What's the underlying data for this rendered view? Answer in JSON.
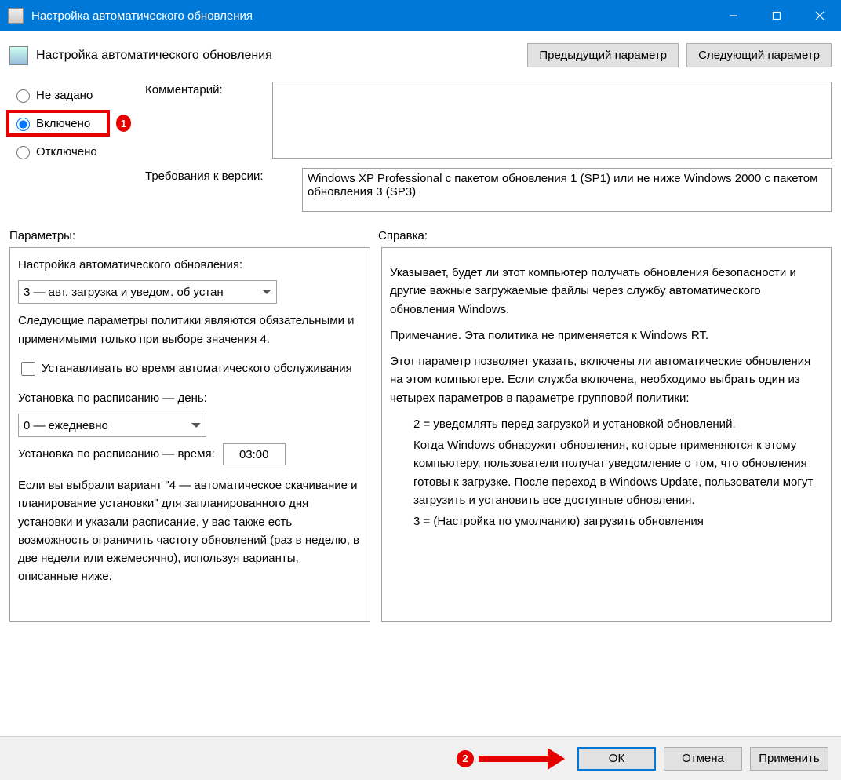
{
  "window": {
    "title": "Настройка автоматического обновления"
  },
  "header": {
    "setting_title": "Настройка автоматического обновления",
    "prev": "Предыдущий параметр",
    "next": "Следующий параметр"
  },
  "state": {
    "not_configured": "Не задано",
    "enabled": "Включено",
    "disabled": "Отключено",
    "selected": "enabled"
  },
  "comment": {
    "label": "Комментарий:",
    "value": ""
  },
  "requirements": {
    "label": "Требования к версии:",
    "value": "Windows XP Professional с пакетом обновления 1 (SP1) или не ниже Windows 2000 с пакетом обновления 3 (SP3)"
  },
  "section_labels": {
    "options": "Параметры:",
    "help": "Справка:"
  },
  "options": {
    "config_label": "Настройка автоматического обновления:",
    "config_value": "3 — авт. загрузка и уведом. об устан",
    "policy_note": "Следующие параметры политики являются обязательными и применимыми только при выборе значения 4.",
    "install_maint_check": "Устанавливать во время автоматического обслуживания",
    "sched_day_label": "Установка по расписанию — день:",
    "sched_day_value": "0 — ежедневно",
    "sched_time_label": "Установка по расписанию — время:",
    "sched_time_value": "03:00",
    "note_tail": "Если вы выбрали вариант \"4 — автоматическое скачивание и планирование установки\" для запланированного дня установки и указали расписание, у вас также есть возможность ограничить частоту обновлений (раз в неделю, в две недели или ежемесячно), используя варианты, описанные ниже."
  },
  "help": {
    "p1": "Указывает, будет ли этот компьютер получать обновления безопасности и другие важные загружаемые файлы через службу автоматического обновления Windows.",
    "p2": "Примечание. Эта политика не применяется к Windows RT.",
    "p3": "Этот параметр позволяет указать, включены ли автоматические обновления на этом компьютере. Если служба включена, необходимо выбрать один из четырех параметров в параметре групповой политики:",
    "opt2": "2 = уведомлять перед загрузкой и установкой обновлений.",
    "opt2_desc": "Когда Windows обнаружит обновления, которые применяются к этому компьютеру, пользователи получат уведомление о том, что обновления готовы к загрузке. После переход в Windows Update, пользователи могут загрузить и установить все доступные обновления.",
    "opt3": "3 = (Настройка по умолчанию) загрузить обновления"
  },
  "footer": {
    "ok": "ОК",
    "cancel": "Отмена",
    "apply": "Применить"
  },
  "markers": {
    "one": "1",
    "two": "2"
  }
}
